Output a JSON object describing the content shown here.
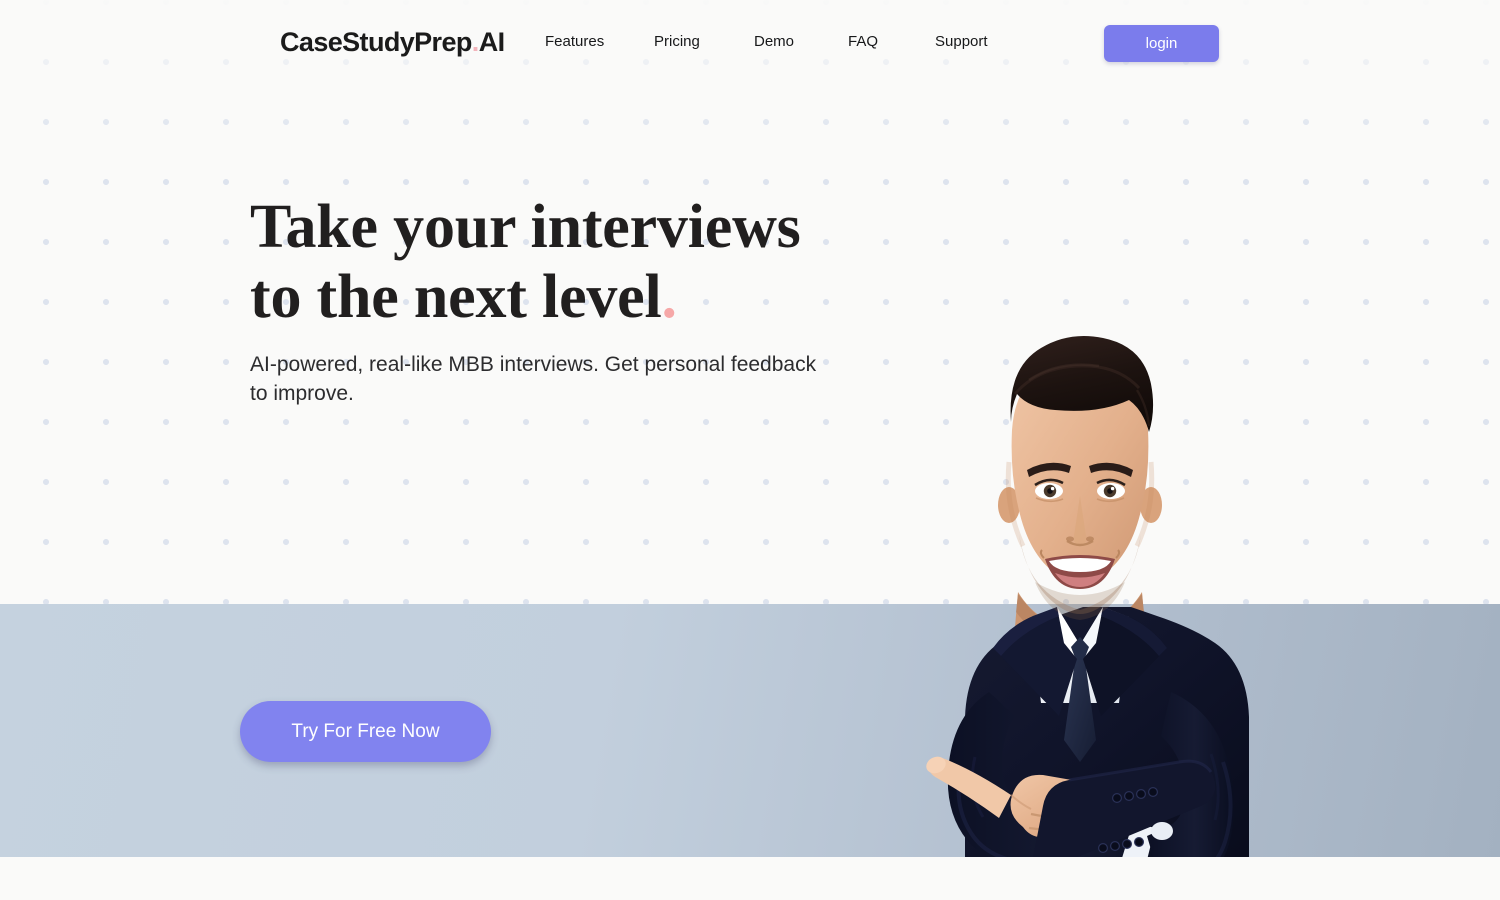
{
  "header": {
    "logo_main": "CaseStudyPrep",
    "logo_dot": ".",
    "logo_suffix": "AI",
    "nav": [
      {
        "label": "Features"
      },
      {
        "label": "Pricing"
      },
      {
        "label": "Demo"
      },
      {
        "label": "FAQ"
      },
      {
        "label": "Support"
      }
    ],
    "login_label": "login"
  },
  "hero": {
    "headline_line1": "Take your interviews",
    "headline_line2": "to the next level",
    "headline_period": ".",
    "subheadline": "AI-powered, real-like MBB interviews. Get personal feedback to improve.",
    "cta_label": "Try For Free Now",
    "image_alt": "smiling-businessman-pointing-left"
  },
  "colors": {
    "page_background": "#fafaf9",
    "accent_purple": "#7b7cec",
    "cta_purple": "#8183ef",
    "accent_pink": "#f6a8a8",
    "band_left": "#c5d2df",
    "band_right": "#a3b1c1",
    "dot_pattern": "#dde3ee",
    "heading_text": "#211f1f",
    "body_text": "#2c2c2e",
    "suit_navy": "#11152b",
    "shirt_white": "#eef1f6",
    "skin": "#e8b694"
  }
}
